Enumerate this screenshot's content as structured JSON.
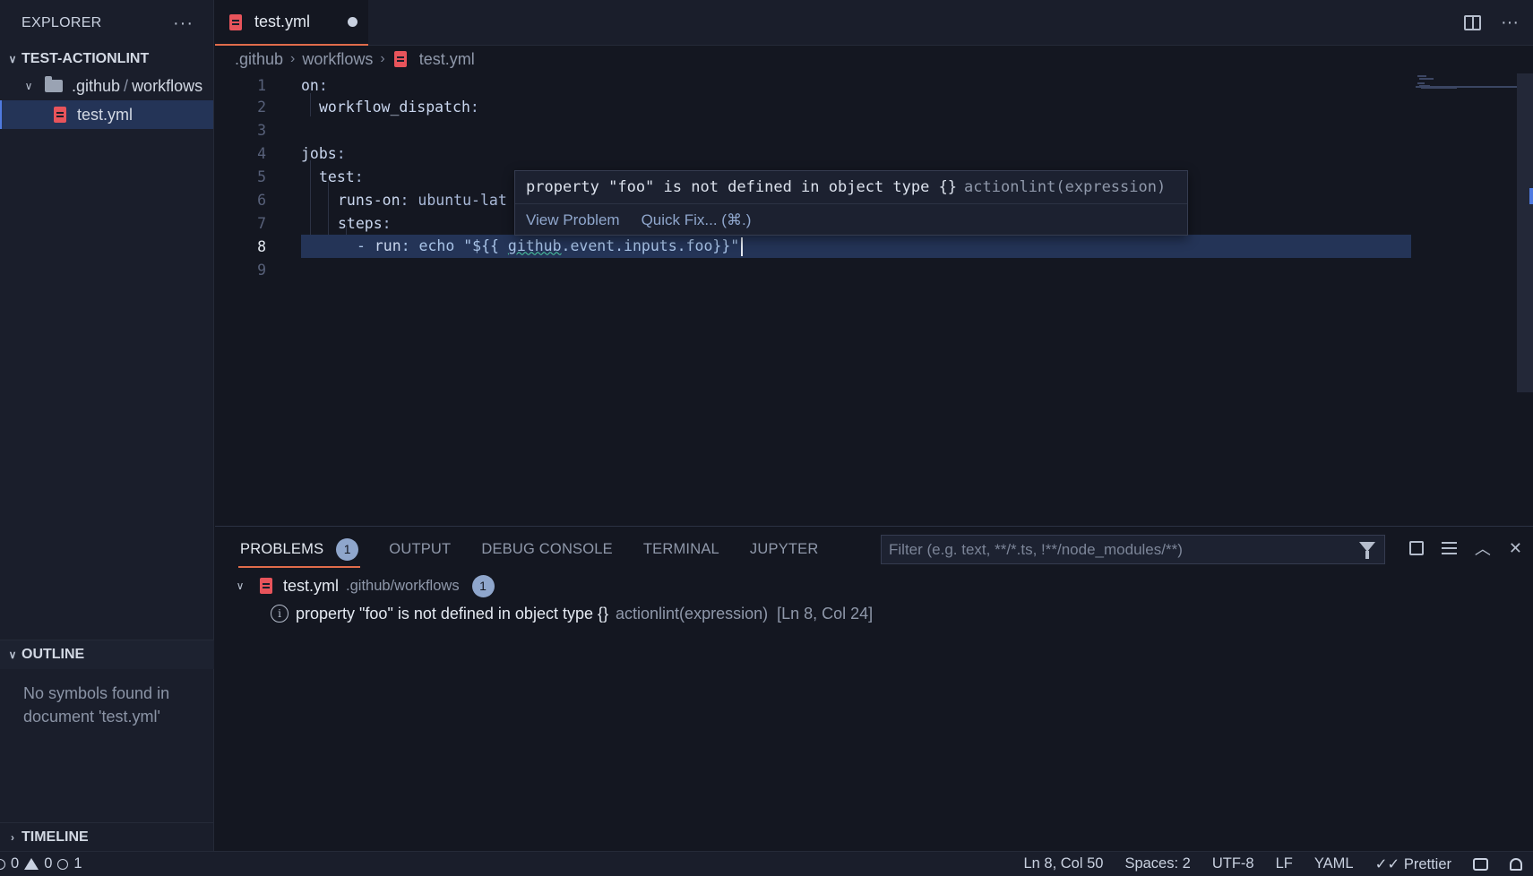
{
  "sidebar": {
    "title": "EXPLORER",
    "more_label": "···",
    "workspace": "TEST-ACTIONLINT",
    "folder": {
      "part1": ".github",
      "sep": "/",
      "part2": "workflows"
    },
    "file": "test.yml",
    "outline": {
      "title": "OUTLINE",
      "empty": "No symbols found in document 'test.yml'"
    },
    "timeline": {
      "title": "TIMELINE"
    }
  },
  "tab": {
    "label": "test.yml",
    "dirty": true
  },
  "breadcrumb": {
    "items": [
      ".github",
      "workflows",
      "test.yml"
    ]
  },
  "editor": {
    "line_numbers": [
      "1",
      "2",
      "3",
      "4",
      "5",
      "6",
      "7",
      "8",
      "9"
    ],
    "current_line": 8,
    "lines": [
      {
        "key": "on",
        "rest": ":"
      },
      {
        "key": "workflow_dispatch",
        "rest": ":"
      },
      {
        "key": "",
        "rest": ""
      },
      {
        "key": "jobs",
        "rest": ":"
      },
      {
        "key": "test",
        "rest": ":"
      },
      {
        "key": "runs-on",
        "rest": ": ubuntu-lat"
      },
      {
        "key": "steps",
        "rest": ":"
      },
      {
        "dash": "- ",
        "key": "run",
        "rest": ": echo \"${{ ",
        "squiggle": "github",
        "tail": ".event.inputs.foo}}\""
      },
      {
        "key": "",
        "rest": ""
      }
    ]
  },
  "hover": {
    "message": "property \"foo\" is not defined in object type {}",
    "source": "actionlint(expression)",
    "view_problem": "View Problem",
    "quick_fix": "Quick Fix... (⌘.)"
  },
  "panel": {
    "tabs": [
      "PROBLEMS",
      "OUTPUT",
      "DEBUG CONSOLE",
      "TERMINAL",
      "JUPYTER"
    ],
    "problems_count": "1",
    "filter_placeholder": "Filter (e.g. text, **/*.ts, !**/node_modules/**)",
    "file": {
      "name": "test.yml",
      "path": ".github/workflows",
      "count": "1"
    },
    "problem": {
      "message": "property \"foo\" is not defined in object type {}",
      "source": "actionlint(expression)",
      "location": "[Ln 8, Col 24]"
    }
  },
  "statusbar": {
    "errors": "0",
    "warnings": "0",
    "infos": "1",
    "position": "Ln 8, Col 50",
    "spaces": "Spaces: 2",
    "encoding": "UTF-8",
    "eol": "LF",
    "language": "YAML",
    "formatter": "Prettier"
  },
  "colors": {
    "accent": "#e06c4b",
    "selection": "#243457",
    "file_icon": "#e8545b",
    "badge": "#8fa6cc"
  },
  "icons": [
    "file-yaml-icon",
    "folder-open-icon",
    "split-editor-icon",
    "filter-icon",
    "info-icon",
    "bell-icon",
    "feedback-icon"
  ]
}
